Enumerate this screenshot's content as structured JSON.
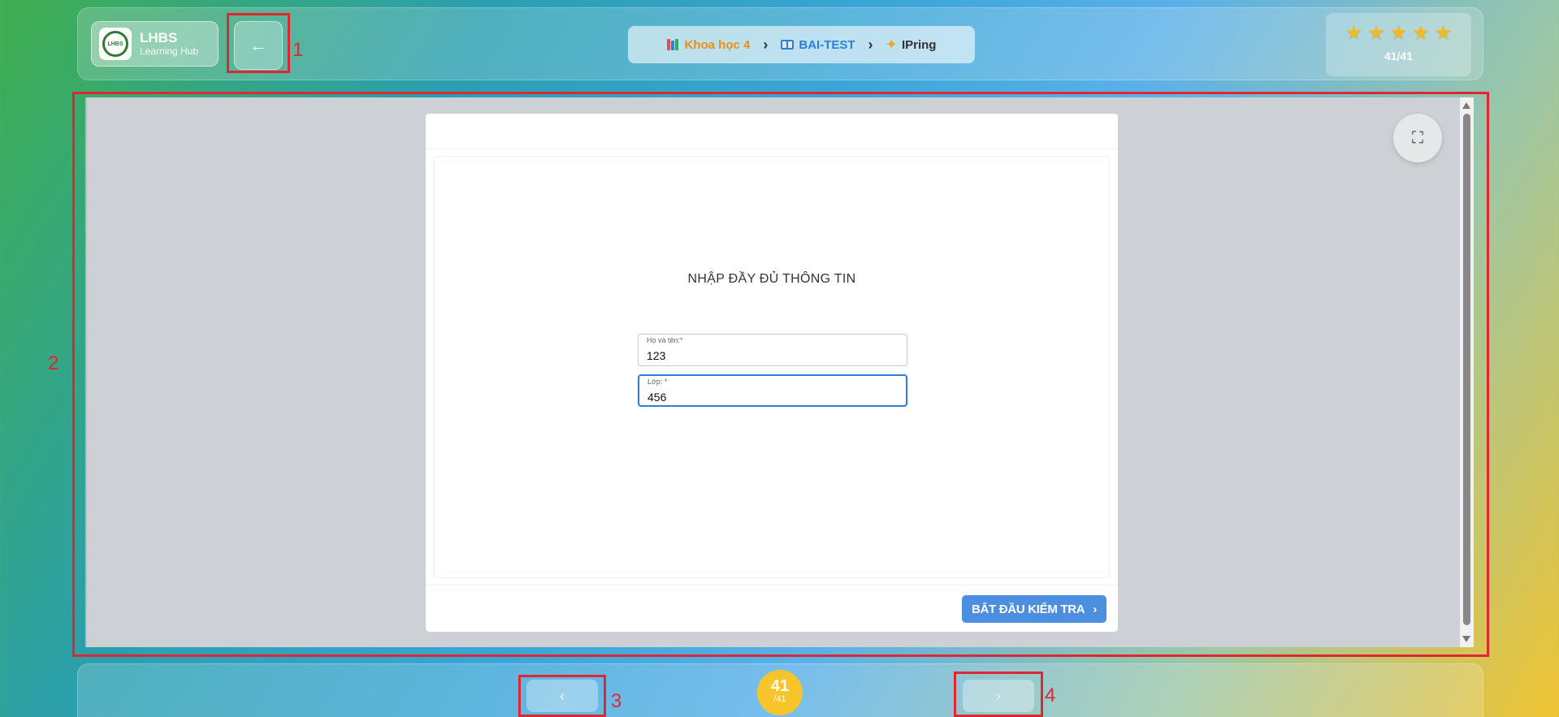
{
  "header": {
    "logo": {
      "title": "LHBS",
      "subtitle": "Learning Hub",
      "mark": "LHBS"
    },
    "back_icon": "←",
    "breadcrumb": [
      {
        "label": "Khoa học 4",
        "icon": "books-icon"
      },
      {
        "label": "BAI-TEST",
        "icon": "book-icon"
      },
      {
        "label": "IPring",
        "icon": "sparkle-icon"
      }
    ],
    "breadcrumb_sep": "›",
    "stars": [
      "★",
      "★",
      "★",
      "★",
      "★"
    ],
    "progress_text": "41/41"
  },
  "content": {
    "fullscreen_icon": "⛶",
    "form_title": "NHẬP ĐẦY ĐỦ THÔNG TIN",
    "fields": [
      {
        "label": "Họ và tên:*",
        "value": "123"
      },
      {
        "label": "Lớp: *",
        "value": "456"
      }
    ],
    "start_button": "BẮT ĐẦU KIỂM TRA",
    "start_chevron": "›"
  },
  "footer": {
    "prev_icon": "‹",
    "next_icon": "›",
    "current": "41",
    "total": "/41"
  },
  "annotations": [
    "1",
    "2",
    "3",
    "4"
  ],
  "colors": {
    "accent": "#4c8fe0",
    "crumb_orange": "#f08c16",
    "crumb_blue": "#2f7fd8",
    "star": "#f6b820",
    "badge": "#f7c52a",
    "annotation": "#e0262e"
  }
}
